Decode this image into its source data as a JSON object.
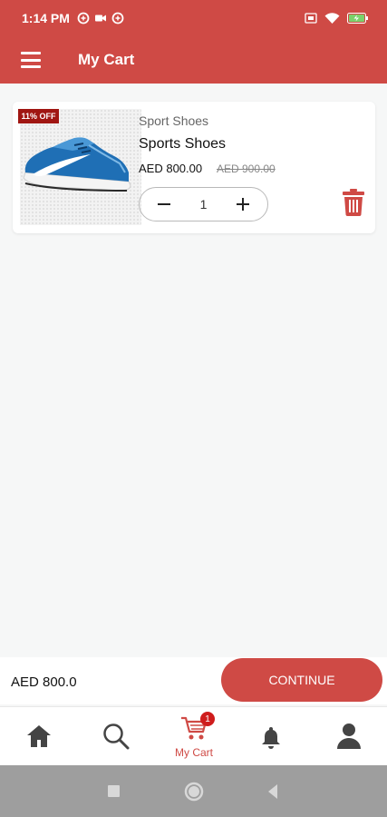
{
  "status_bar": {
    "time": "1:14 PM",
    "left_icons": [
      "data-saver-icon",
      "video-icon",
      "data-saver-icon"
    ],
    "right_icons": [
      "sim-icon",
      "wifi-icon",
      "battery-charging-icon"
    ]
  },
  "header": {
    "title": "My Cart",
    "menu_icon": "hamburger-menu-icon",
    "color": "#cf4a45"
  },
  "cart": {
    "items": [
      {
        "discount_badge": "11% OFF",
        "category": "Sport Shoes",
        "name": "Sports Shoes",
        "price": "AED 800.00",
        "old_price": "AED 900.00",
        "quantity": "1",
        "image_icon": "blue-sneaker-image",
        "delete_icon": "trash-icon"
      }
    ]
  },
  "checkout": {
    "total": "AED 800.0",
    "continue_label": "CONTINUE"
  },
  "bottom_nav": {
    "items": [
      {
        "icon": "home-icon",
        "label": ""
      },
      {
        "icon": "search-icon",
        "label": ""
      },
      {
        "icon": "cart-icon",
        "label": "My Cart",
        "badge": "1",
        "active": true
      },
      {
        "icon": "bell-icon",
        "label": ""
      },
      {
        "icon": "user-icon",
        "label": ""
      }
    ],
    "active_color": "#cf4a45"
  },
  "system_nav": [
    "recents-icon",
    "home-circle-icon",
    "back-icon"
  ]
}
